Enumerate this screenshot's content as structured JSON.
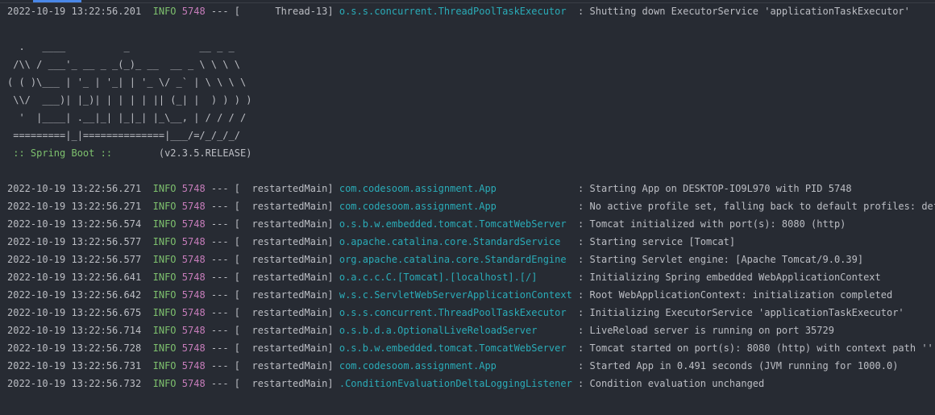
{
  "colors": {
    "background": "#272b33",
    "text": "#bcbec4",
    "level": "#7ec16e",
    "pid": "#c77dbb",
    "logger": "#2aacb8",
    "tab_indicator": "#4a88e8"
  },
  "first_log": {
    "ts": "2022-10-19 13:22:56.201",
    "level": "INFO",
    "pid": "5748",
    "thread": "Thread-13",
    "logger": "o.s.s.concurrent.ThreadPoolTaskExecutor",
    "msg": "Shutting down ExecutorService 'applicationTaskExecutor'"
  },
  "banner": [
    "  .   ____          _            __ _ _",
    " /\\\\ / ___'_ __ _ _(_)_ __  __ _ \\ \\ \\ \\",
    "( ( )\\___ | '_ | '_| | '_ \\/ _` | \\ \\ \\ \\",
    " \\\\/  ___)| |_)| | | | | || (_| |  ) ) ) )",
    "  '  |____| .__|_| |_|_| |_\\__, | / / / /",
    " =========|_|==============|___/=/_/_/_/"
  ],
  "spring_label": " :: Spring Boot :: ",
  "spring_version": "       (v2.3.5.RELEASE)",
  "logs": [
    {
      "ts": "2022-10-19 13:22:56.271",
      "level": "INFO",
      "pid": "5748",
      "thread": "restartedMain",
      "logger": "com.codesoom.assignment.App",
      "msg": "Starting App on DESKTOP-IO9L970 with PID 5748"
    },
    {
      "ts": "2022-10-19 13:22:56.271",
      "level": "INFO",
      "pid": "5748",
      "thread": "restartedMain",
      "logger": "com.codesoom.assignment.App",
      "msg": "No active profile set, falling back to default profiles: default"
    },
    {
      "ts": "2022-10-19 13:22:56.574",
      "level": "INFO",
      "pid": "5748",
      "thread": "restartedMain",
      "logger": "o.s.b.w.embedded.tomcat.TomcatWebServer",
      "msg": "Tomcat initialized with port(s): 8080 (http)"
    },
    {
      "ts": "2022-10-19 13:22:56.577",
      "level": "INFO",
      "pid": "5748",
      "thread": "restartedMain",
      "logger": "o.apache.catalina.core.StandardService",
      "msg": "Starting service [Tomcat]"
    },
    {
      "ts": "2022-10-19 13:22:56.577",
      "level": "INFO",
      "pid": "5748",
      "thread": "restartedMain",
      "logger": "org.apache.catalina.core.StandardEngine",
      "msg": "Starting Servlet engine: [Apache Tomcat/9.0.39]"
    },
    {
      "ts": "2022-10-19 13:22:56.641",
      "level": "INFO",
      "pid": "5748",
      "thread": "restartedMain",
      "logger": "o.a.c.c.C.[Tomcat].[localhost].[/]",
      "msg": "Initializing Spring embedded WebApplicationContext"
    },
    {
      "ts": "2022-10-19 13:22:56.642",
      "level": "INFO",
      "pid": "5748",
      "thread": "restartedMain",
      "logger": "w.s.c.ServletWebServerApplicationContext",
      "msg": "Root WebApplicationContext: initialization completed"
    },
    {
      "ts": "2022-10-19 13:22:56.675",
      "level": "INFO",
      "pid": "5748",
      "thread": "restartedMain",
      "logger": "o.s.s.concurrent.ThreadPoolTaskExecutor",
      "msg": "Initializing ExecutorService 'applicationTaskExecutor'"
    },
    {
      "ts": "2022-10-19 13:22:56.714",
      "level": "INFO",
      "pid": "5748",
      "thread": "restartedMain",
      "logger": "o.s.b.d.a.OptionalLiveReloadServer",
      "msg": "LiveReload server is running on port 35729"
    },
    {
      "ts": "2022-10-19 13:22:56.728",
      "level": "INFO",
      "pid": "5748",
      "thread": "restartedMain",
      "logger": "o.s.b.w.embedded.tomcat.TomcatWebServer",
      "msg": "Tomcat started on port(s): 8080 (http) with context path ''"
    },
    {
      "ts": "2022-10-19 13:22:56.731",
      "level": "INFO",
      "pid": "5748",
      "thread": "restartedMain",
      "logger": "com.codesoom.assignment.App",
      "msg": "Started App in 0.491 seconds (JVM running for 1000.0)"
    },
    {
      "ts": "2022-10-19 13:22:56.732",
      "level": "INFO",
      "pid": "5748",
      "thread": "restartedMain",
      "logger": ".ConditionEvaluationDeltaLoggingListener",
      "msg": "Condition evaluation unchanged"
    }
  ]
}
